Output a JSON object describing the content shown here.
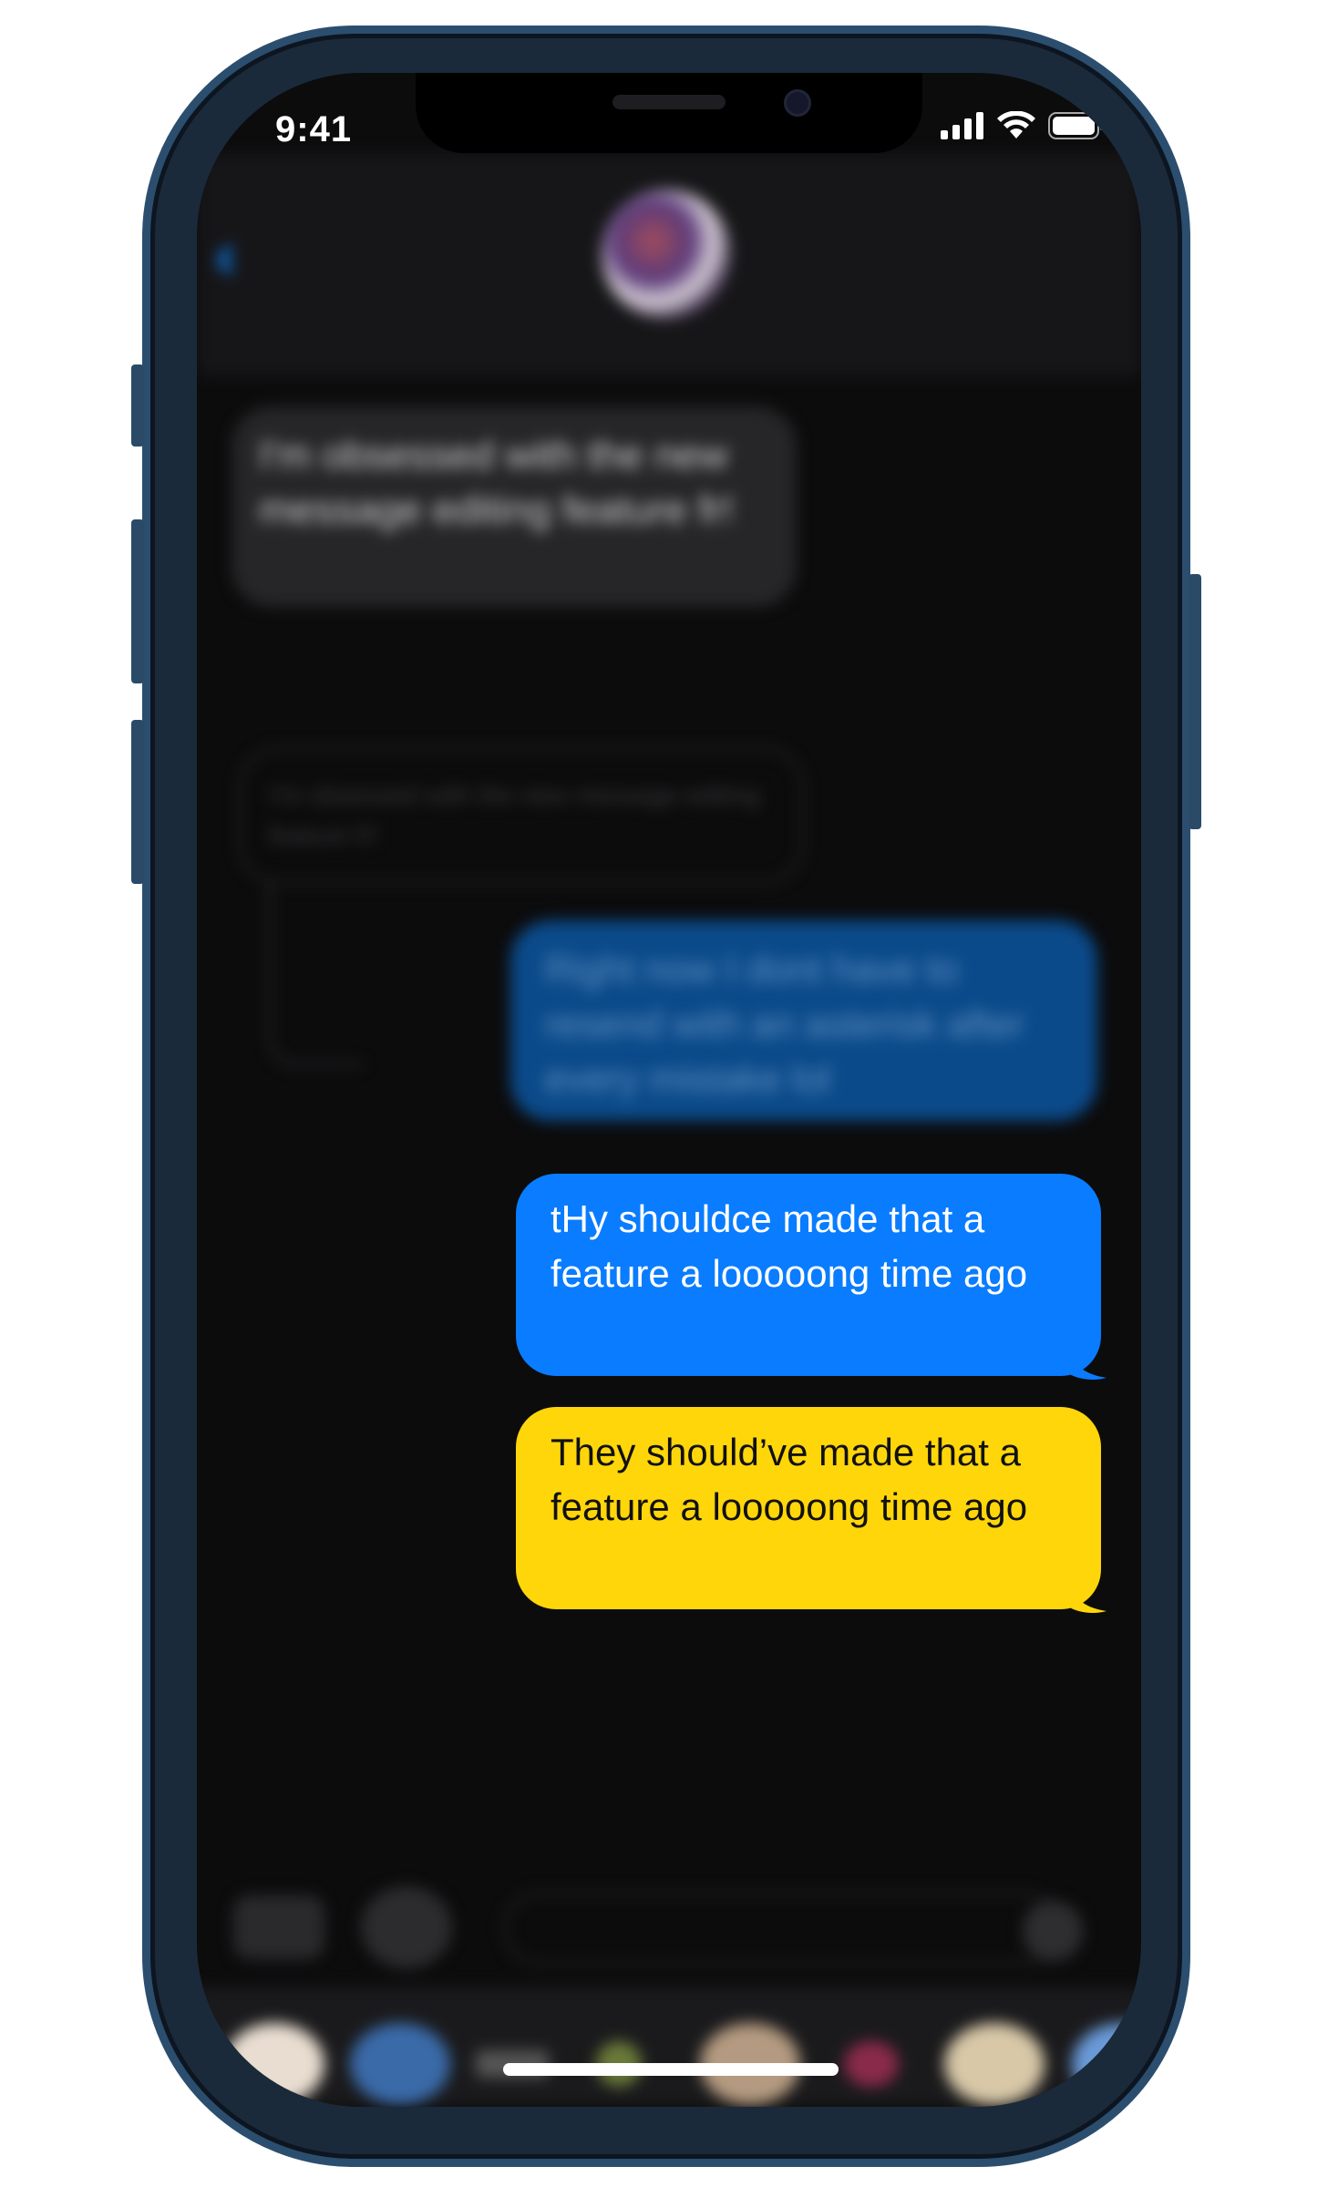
{
  "status_bar": {
    "time": "9:41"
  },
  "conversation": {
    "messages": [
      {
        "direction": "incoming",
        "text": "I'm obsessed with the new message editing feature fr!"
      },
      {
        "direction": "outgoing",
        "text": "Right now I dont have to resend with an asterisk after every mistake lol"
      },
      {
        "direction": "outgoing",
        "text": "tHy shouldce made that a feature a looooong time ago"
      },
      {
        "direction": "outgoing",
        "text": "They should’ve made that a feature a looooong time ago"
      }
    ]
  },
  "colors": {
    "outgoing_blue": "#0a7cff",
    "highlight_yellow": "#ffd60a",
    "screen_background": "#0c0c0d",
    "frame": "#2b4e6e"
  },
  "icons": [
    "back-chevron-icon",
    "signal-icon",
    "wifi-icon",
    "battery-icon",
    "camera-icon",
    "app-store-icon",
    "microphone-icon"
  ]
}
